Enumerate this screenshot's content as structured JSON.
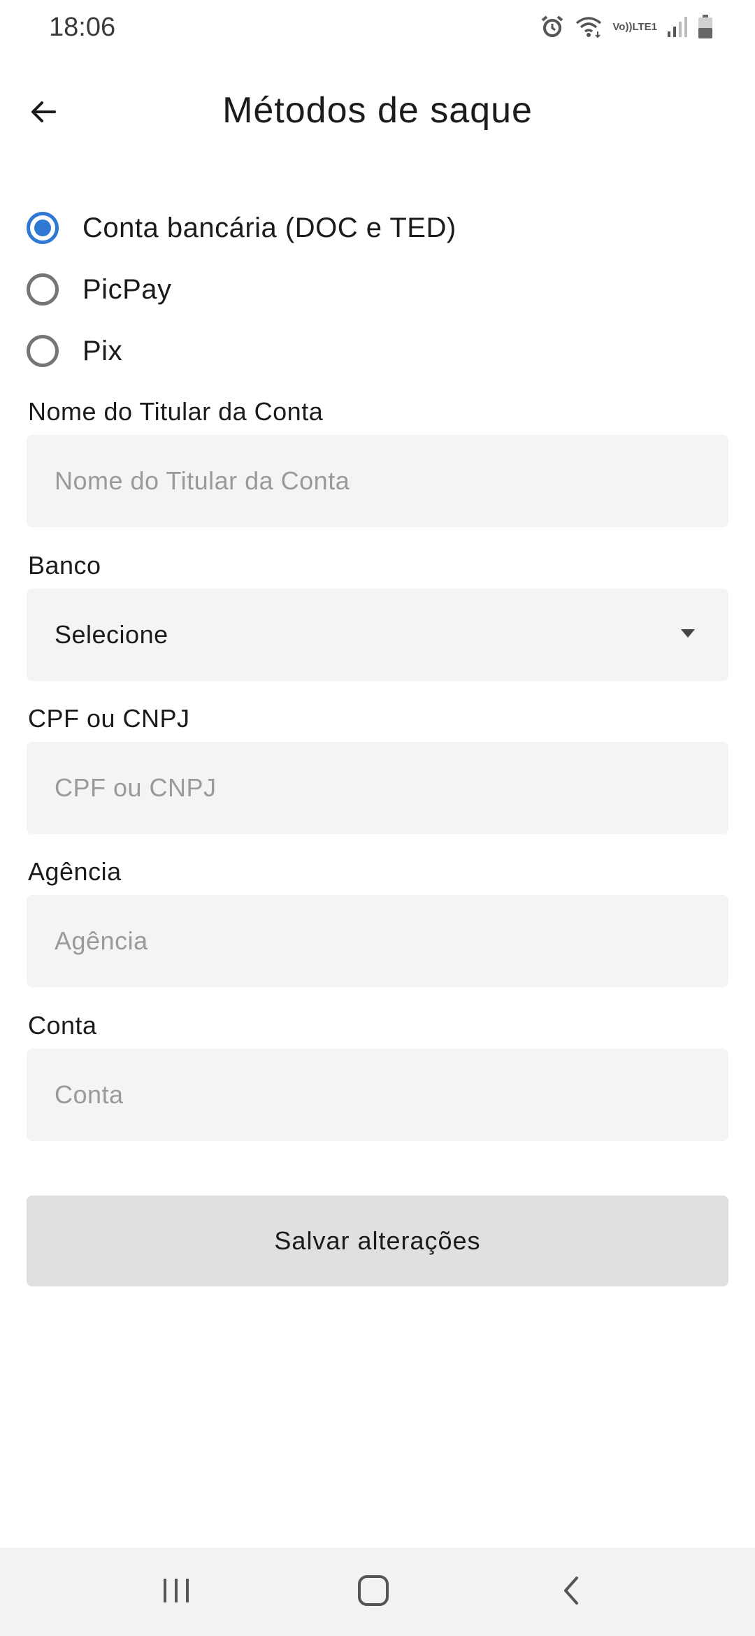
{
  "status_bar": {
    "time": "18:06",
    "network_top": "Vo))",
    "network_bottom": "LTE1"
  },
  "header": {
    "title": "Métodos de saque"
  },
  "payment_methods": {
    "options": [
      {
        "label": "Conta bancária (DOC e TED)",
        "selected": true
      },
      {
        "label": "PicPay",
        "selected": false
      },
      {
        "label": "Pix",
        "selected": false
      }
    ]
  },
  "form": {
    "holder_name": {
      "label": "Nome do Titular da Conta",
      "placeholder": "Nome do Titular da Conta",
      "value": ""
    },
    "bank": {
      "label": "Banco",
      "value": "Selecione"
    },
    "document": {
      "label": "CPF ou CNPJ",
      "placeholder": "CPF ou CNPJ",
      "value": ""
    },
    "agency": {
      "label": "Agência",
      "placeholder": "Agência",
      "value": ""
    },
    "account": {
      "label": "Conta",
      "placeholder": "Conta",
      "value": ""
    }
  },
  "actions": {
    "save_label": "Salvar alterações"
  },
  "colors": {
    "accent": "#2f78d4",
    "field_bg": "#f4f4f4",
    "button_bg": "#e0e0e0"
  },
  "icons": {
    "back": "arrow-left-icon",
    "status": [
      "alarm-icon",
      "wifi-icon",
      "signal-icon",
      "battery-icon"
    ],
    "nav": [
      "recent-apps-icon",
      "home-icon",
      "nav-back-icon"
    ]
  }
}
